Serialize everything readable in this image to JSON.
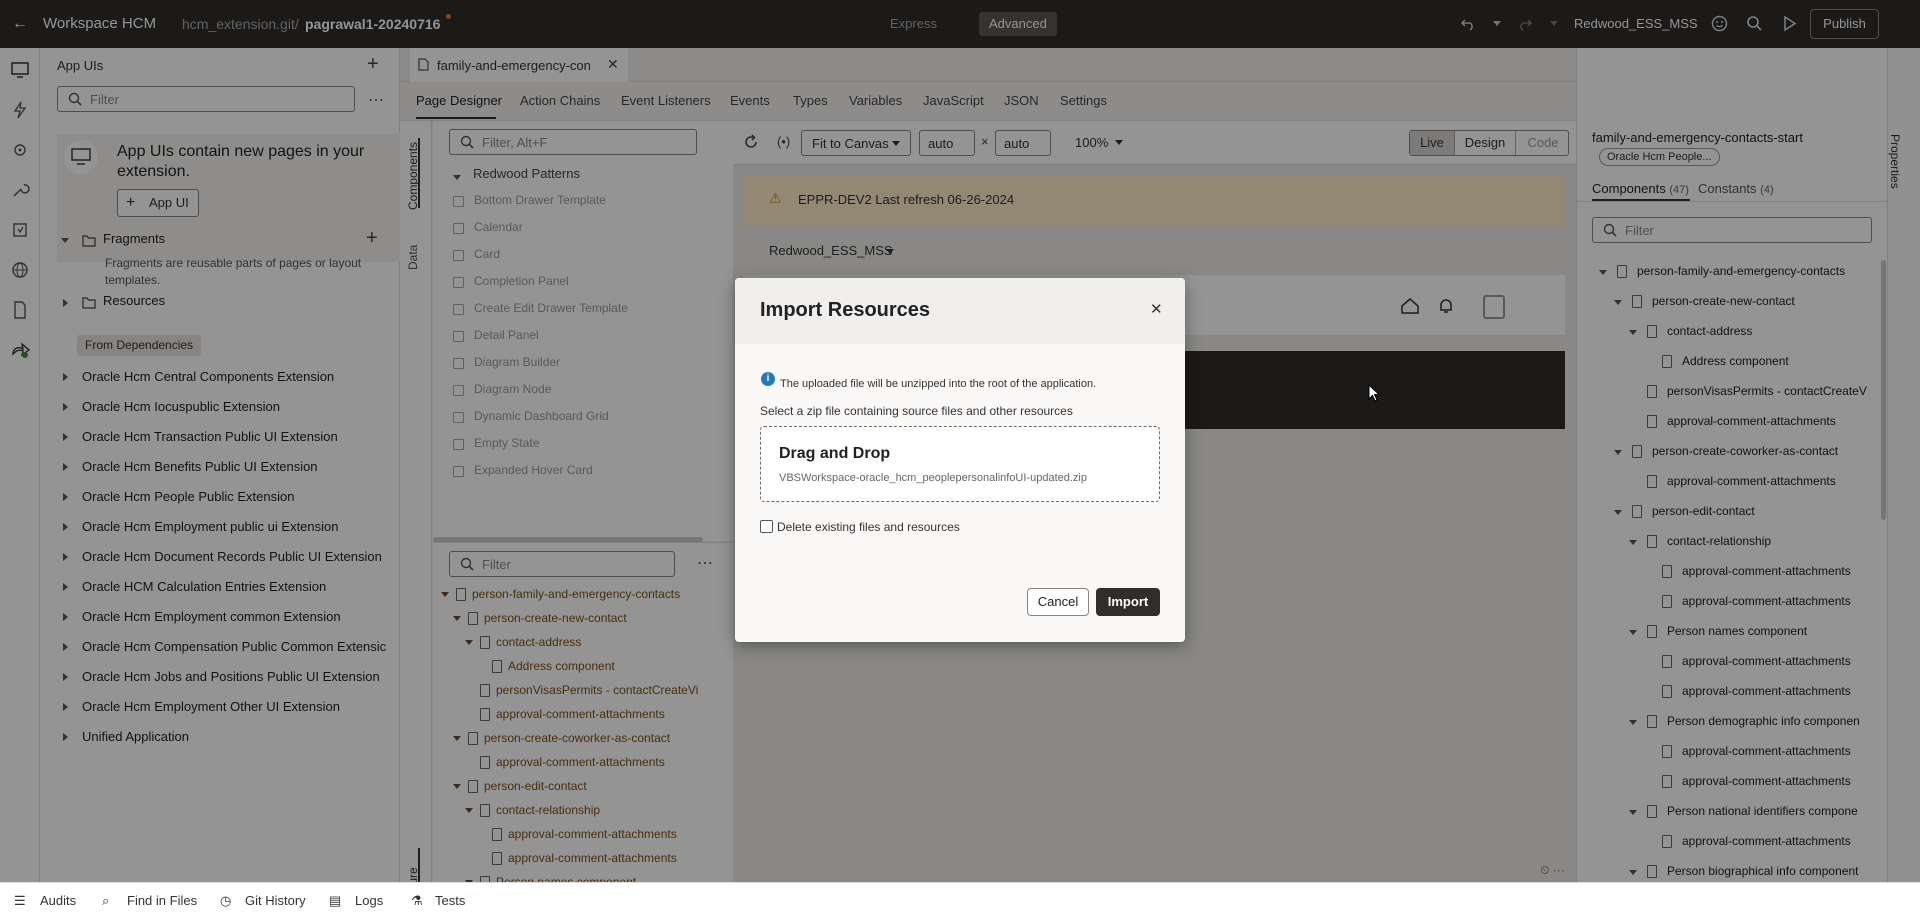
{
  "topbar": {
    "workspace": "Workspace HCM",
    "repo": "hcm_extension.git/",
    "branch": "pagrawal1-20240716",
    "mode_express": "Express",
    "mode_advanced": "Advanced",
    "profile": "Redwood_ESS_MSS",
    "publish": "Publish"
  },
  "left": {
    "title": "App UIs",
    "filter_placeholder": "Filter",
    "info_text_1": "App UIs contain new pages in your",
    "info_text_2": "extension.",
    "app_ui_button": "App UI",
    "fragments": "Fragments",
    "fragments_desc_1": "Fragments are reusable parts of pages or layout",
    "fragments_desc_2": "templates.",
    "resources": "Resources",
    "from_dependencies": "From Dependencies",
    "dependencies": [
      "Oracle Hcm Central Components Extension",
      "Oracle Hcm Iocuspublic Extension",
      "Oracle Hcm Transaction Public UI Extension",
      "Oracle Hcm Benefits Public UI Extension",
      "Oracle Hcm People Public Extension",
      "Oracle Hcm Employment public ui Extension",
      "Oracle Hcm Document Records Public UI Extension",
      "Oracle HCM Calculation Entries Extension",
      "Oracle Hcm Employment common Extension",
      "Oracle Hcm Compensation Public Common Extensic",
      "Oracle Hcm Jobs and Positions Public UI Extension",
      "Oracle Hcm Employment Other UI Extension",
      "Unified Application"
    ]
  },
  "editor": {
    "file_tab": "family-and-emergency-con",
    "tabs": [
      "Page Designer",
      "Action Chains",
      "Event Listeners",
      "Events",
      "Types",
      "Variables",
      "JavaScript",
      "JSON",
      "Settings"
    ],
    "side_tabs": {
      "components": "Components",
      "data": "Data",
      "structure": "Structure"
    },
    "palette_filter": "Filter, Alt+F",
    "palette_group": "Redwood Patterns",
    "palette_items": [
      "Bottom Drawer Template",
      "Calendar",
      "Card",
      "Completion Panel",
      "Create Edit Drawer Template",
      "Detail Panel",
      "Diagram Builder",
      "Diagram Node",
      "Dynamic Dashboard Grid",
      "Empty State",
      "Expanded Hover Card"
    ],
    "structure_filter": "Filter",
    "structure_items": [
      "person-family-and-emergency-contacts",
      "person-create-new-contact",
      "contact-address",
      "Address component",
      "personVisasPermits - contactCreateVi",
      "approval-comment-attachments",
      "person-create-coworker-as-contact",
      "approval-comment-attachments",
      "person-edit-contact",
      "contact-relationship",
      "approval-comment-attachments",
      "approval-comment-attachments",
      "Person names component"
    ],
    "fit": "Fit to Canvas",
    "width": "auto",
    "height": "auto",
    "zoom": "100%",
    "view_live": "Live",
    "view_design": "Design",
    "view_code": "Code",
    "canvas_banner": "EPPR-DEV2 Last refresh 06-26-2024",
    "canvas_profile": "Redwood_ESS_MSS"
  },
  "props": {
    "title": "family-and-emergency-contacts-start",
    "chip": "Oracle Hcm People...",
    "tab_components": "Components",
    "components_count": "(47)",
    "tab_constants": "Constants",
    "constants_count": "(4)",
    "filter_placeholder": "Filter",
    "side_label": "Properties",
    "tree": [
      "person-family-and-emergency-contacts",
      "person-create-new-contact",
      "contact-address",
      "Address component",
      "personVisasPermits - contactCreateV",
      "approval-comment-attachments",
      "person-create-coworker-as-contact",
      "approval-comment-attachments",
      "person-edit-contact",
      "contact-relationship",
      "approval-comment-attachments",
      "approval-comment-attachments",
      "Person names component",
      "approval-comment-attachments",
      "approval-comment-attachments",
      "Person demographic info componen",
      "approval-comment-attachments",
      "approval-comment-attachments",
      "Person national identifiers compone",
      "approval-comment-attachments",
      "Person biographical info component"
    ]
  },
  "bottom": {
    "audits": "Audits",
    "find": "Find in Files",
    "git": "Git History",
    "logs": "Logs",
    "tests": "Tests"
  },
  "modal": {
    "title": "Import Resources",
    "info": "The uploaded file will be unzipped into the root of the application.",
    "select_label": "Select a zip file containing source files and other resources",
    "drop_title": "Drag and Drop",
    "drop_file": "VBSWorkspace-oracle_hcm_peoplepersonalinfoUI-updated.zip",
    "delete_label": "Delete existing files and resources",
    "cancel": "Cancel",
    "import": "Import"
  }
}
